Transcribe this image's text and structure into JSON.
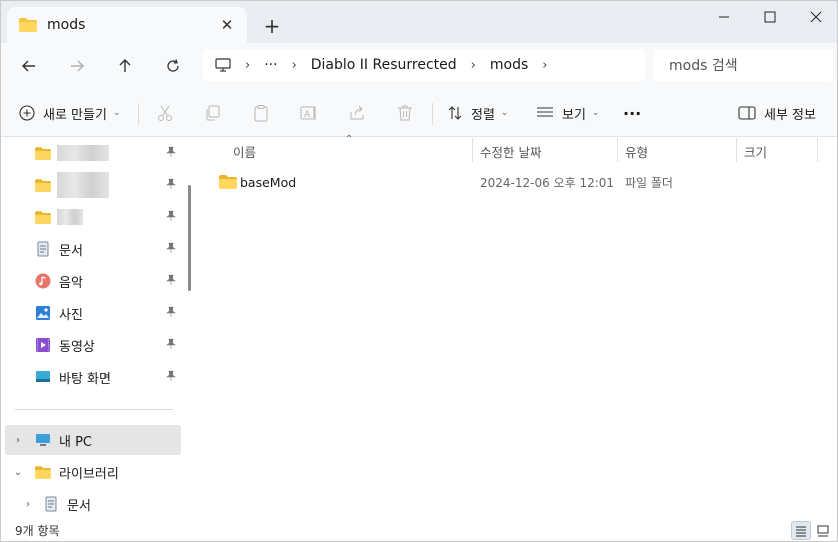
{
  "tab": {
    "title": "mods",
    "close": "✕",
    "new": "+"
  },
  "window_controls": {
    "minimize": "—",
    "maximize": "☐",
    "close": "✕"
  },
  "nav": {
    "ellipsis": "···"
  },
  "breadcrumb": [
    "Diablo II Resurrected",
    "mods"
  ],
  "search": {
    "placeholder": "mods 검색"
  },
  "toolbar": {
    "new_label": "새로 만들기",
    "sort_label": "정렬",
    "view_label": "보기",
    "more_label": "···",
    "details_label": "세부 정보"
  },
  "sidebar": {
    "quick_access": [
      {
        "label": "",
        "blurred": true
      },
      {
        "label": "",
        "blurred": true
      },
      {
        "label": "",
        "blurred": true
      },
      {
        "label": "문서"
      },
      {
        "label": "음악"
      },
      {
        "label": "사진"
      },
      {
        "label": "동영상"
      },
      {
        "label": "바탕 화면"
      }
    ],
    "tree": [
      {
        "label": "내 PC"
      },
      {
        "label": "라이브러리"
      },
      {
        "label": "문서"
      }
    ]
  },
  "columns": {
    "name": "이름",
    "date": "수정한 날짜",
    "type": "유형",
    "size": "크기"
  },
  "files": [
    {
      "name": "baseMod",
      "date": "2024-12-06 오후 12:01",
      "type": "파일 폴더",
      "size": ""
    }
  ],
  "status": {
    "item_count": "9개 항목"
  },
  "colors": {
    "folder": "#f5c542",
    "accent": "#0067c0",
    "selected": "#e5e5e5",
    "title_bg": "#eaeef3"
  }
}
